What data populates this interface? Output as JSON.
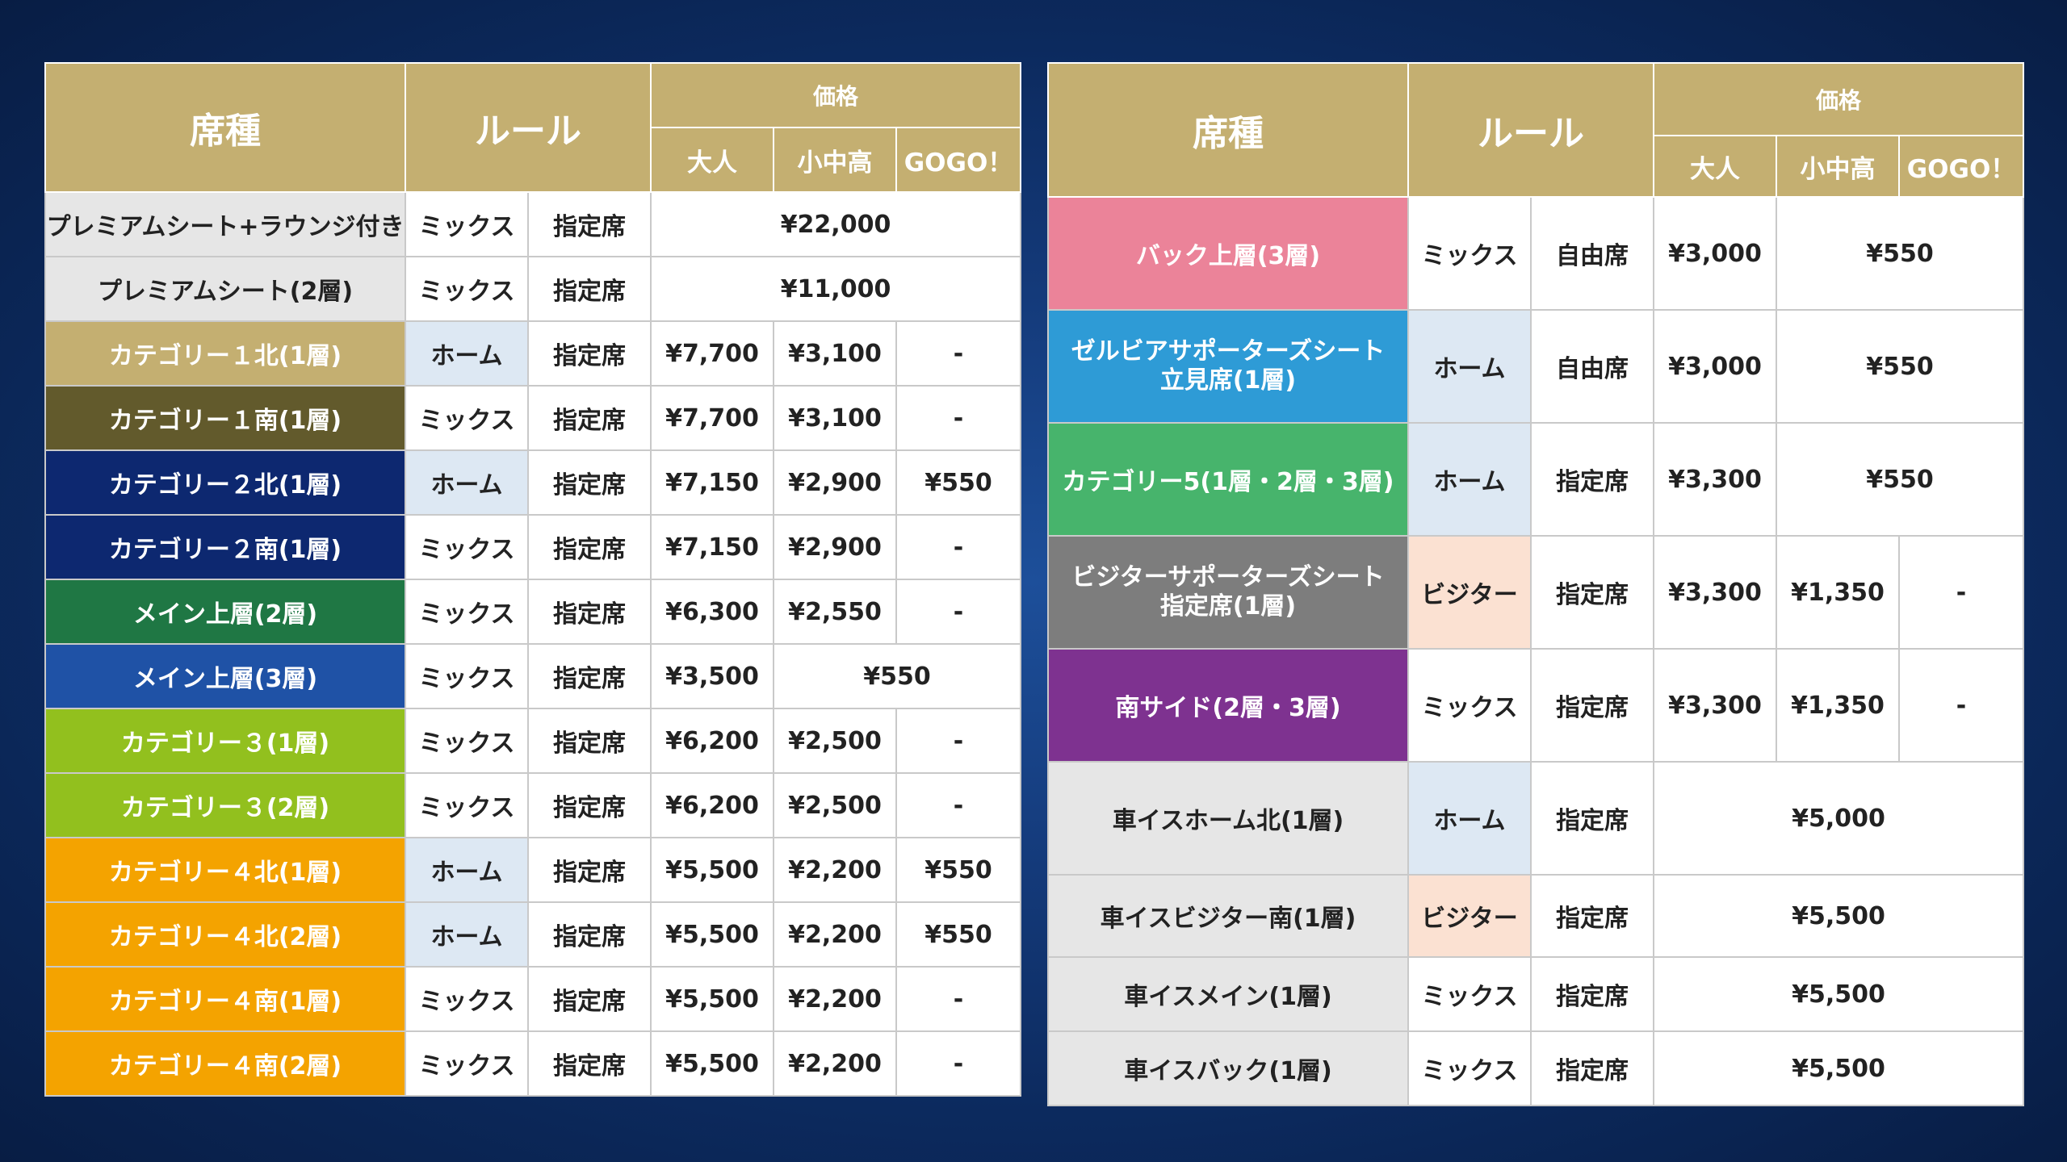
{
  "header": {
    "seat_type": "席種",
    "rule": "ルール",
    "price": "価格",
    "adult": "大人",
    "child": "小中高",
    "gogo": "GOGO！"
  },
  "colors": {
    "header_gold": "#c4af71",
    "home_bg": "#dde8f3",
    "visitor_bg": "#fbe1d2"
  },
  "left_table": [
    {
      "seat": "プレミアムシート+ラウンジ付き",
      "bg": "#e6e6e6",
      "fg": "#222222",
      "rule": "ミックス",
      "rule_type": "mix",
      "seating": "指定席",
      "prices": [
        "¥22,000"
      ],
      "spans": [
        3
      ]
    },
    {
      "seat": "プレミアムシート(2層)",
      "bg": "#e6e6e6",
      "fg": "#222222",
      "rule": "ミックス",
      "rule_type": "mix",
      "seating": "指定席",
      "prices": [
        "¥11,000"
      ],
      "spans": [
        3
      ]
    },
    {
      "seat": "カテゴリー１北(1層)",
      "bg": "#c4af71",
      "fg": "#ffffff",
      "rule": "ホーム",
      "rule_type": "home",
      "seating": "指定席",
      "prices": [
        "¥7,700",
        "¥3,100",
        "-"
      ],
      "spans": [
        1,
        1,
        1
      ]
    },
    {
      "seat": "カテゴリー１南(1層)",
      "bg": "#625a2c",
      "fg": "#ffffff",
      "rule": "ミックス",
      "rule_type": "mix",
      "seating": "指定席",
      "prices": [
        "¥7,700",
        "¥3,100",
        "-"
      ],
      "spans": [
        1,
        1,
        1
      ]
    },
    {
      "seat": "カテゴリー２北(1層)",
      "bg": "#0d2870",
      "fg": "#ffffff",
      "rule": "ホーム",
      "rule_type": "home",
      "seating": "指定席",
      "prices": [
        "¥7,150",
        "¥2,900",
        "¥550"
      ],
      "spans": [
        1,
        1,
        1
      ]
    },
    {
      "seat": "カテゴリー２南(1層)",
      "bg": "#0d2870",
      "fg": "#ffffff",
      "rule": "ミックス",
      "rule_type": "mix",
      "seating": "指定席",
      "prices": [
        "¥7,150",
        "¥2,900",
        "-"
      ],
      "spans": [
        1,
        1,
        1
      ]
    },
    {
      "seat": "メイン上層(2層)",
      "bg": "#1f7744",
      "fg": "#ffffff",
      "rule": "ミックス",
      "rule_type": "mix",
      "seating": "指定席",
      "prices": [
        "¥6,300",
        "¥2,550",
        "-"
      ],
      "spans": [
        1,
        1,
        1
      ]
    },
    {
      "seat": "メイン上層(3層)",
      "bg": "#1f52a6",
      "fg": "#ffffff",
      "rule": "ミックス",
      "rule_type": "mix",
      "seating": "指定席",
      "prices": [
        "¥3,500",
        "¥550"
      ],
      "spans": [
        1,
        2
      ]
    },
    {
      "seat": "カテゴリー３(1層)",
      "bg": "#92c01e",
      "fg": "#ffffff",
      "rule": "ミックス",
      "rule_type": "mix",
      "seating": "指定席",
      "prices": [
        "¥6,200",
        "¥2,500",
        "-"
      ],
      "spans": [
        1,
        1,
        1
      ]
    },
    {
      "seat": "カテゴリー３(2層)",
      "bg": "#92c01e",
      "fg": "#ffffff",
      "rule": "ミックス",
      "rule_type": "mix",
      "seating": "指定席",
      "prices": [
        "¥6,200",
        "¥2,500",
        "-"
      ],
      "spans": [
        1,
        1,
        1
      ]
    },
    {
      "seat": "カテゴリー４北(1層)",
      "bg": "#f4a300",
      "fg": "#ffffff",
      "rule": "ホーム",
      "rule_type": "home",
      "seating": "指定席",
      "prices": [
        "¥5,500",
        "¥2,200",
        "¥550"
      ],
      "spans": [
        1,
        1,
        1
      ]
    },
    {
      "seat": "カテゴリー４北(2層)",
      "bg": "#f4a300",
      "fg": "#ffffff",
      "rule": "ホーム",
      "rule_type": "home",
      "seating": "指定席",
      "prices": [
        "¥5,500",
        "¥2,200",
        "¥550"
      ],
      "spans": [
        1,
        1,
        1
      ]
    },
    {
      "seat": "カテゴリー４南(1層)",
      "bg": "#f4a300",
      "fg": "#ffffff",
      "rule": "ミックス",
      "rule_type": "mix",
      "seating": "指定席",
      "prices": [
        "¥5,500",
        "¥2,200",
        "-"
      ],
      "spans": [
        1,
        1,
        1
      ]
    },
    {
      "seat": "カテゴリー４南(2層)",
      "bg": "#f4a300",
      "fg": "#ffffff",
      "rule": "ミックス",
      "rule_type": "mix",
      "seating": "指定席",
      "prices": [
        "¥5,500",
        "¥2,200",
        "-"
      ],
      "spans": [
        1,
        1,
        1
      ]
    }
  ],
  "right_table": [
    {
      "seat": "バック上層(3層)",
      "bg": "#eb8399",
      "fg": "#ffffff",
      "rule": "ミックス",
      "rule_type": "mix",
      "seating": "自由席",
      "prices": [
        "¥3,000",
        "¥550"
      ],
      "spans": [
        1,
        2
      ]
    },
    {
      "seat": "ゼルビアサポーターズシート\n立見席(1層)",
      "bg": "#2e9bd6",
      "fg": "#ffffff",
      "rule": "ホーム",
      "rule_type": "home",
      "seating": "自由席",
      "prices": [
        "¥3,000",
        "¥550"
      ],
      "spans": [
        1,
        2
      ]
    },
    {
      "seat": "カテゴリー5(1層・2層・3層)",
      "bg": "#47b46c",
      "fg": "#ffffff",
      "rule": "ホーム",
      "rule_type": "home",
      "seating": "指定席",
      "prices": [
        "¥3,300",
        "¥550"
      ],
      "spans": [
        1,
        2
      ]
    },
    {
      "seat": "ビジターサポーターズシート\n指定席(1層)",
      "bg": "#7d7d7d",
      "fg": "#ffffff",
      "rule": "ビジター",
      "rule_type": "visitor",
      "seating": "指定席",
      "prices": [
        "¥3,300",
        "¥1,350",
        "-"
      ],
      "spans": [
        1,
        1,
        1
      ]
    },
    {
      "seat": "南サイド(2層・3層)",
      "bg": "#7e3290",
      "fg": "#ffffff",
      "rule": "ミックス",
      "rule_type": "mix",
      "seating": "指定席",
      "prices": [
        "¥3,300",
        "¥1,350",
        "-"
      ],
      "spans": [
        1,
        1,
        1
      ]
    },
    {
      "seat": "車イスホーム北(1層)",
      "bg": "#e6e6e6",
      "fg": "#222222",
      "rule": "ホーム",
      "rule_type": "home",
      "seating": "指定席",
      "prices": [
        "¥5,000"
      ],
      "spans": [
        3
      ]
    },
    {
      "seat": "車イスビジター南(1層)",
      "bg": "#e6e6e6",
      "fg": "#222222",
      "rule": "ビジター",
      "rule_type": "visitor",
      "seating": "指定席",
      "prices": [
        "¥5,500"
      ],
      "spans": [
        3
      ]
    },
    {
      "seat": "車イスメイン(1層)",
      "bg": "#e6e6e6",
      "fg": "#222222",
      "rule": "ミックス",
      "rule_type": "mix",
      "seating": "指定席",
      "prices": [
        "¥5,500"
      ],
      "spans": [
        3
      ]
    },
    {
      "seat": "車イスバック(1層)",
      "bg": "#e6e6e6",
      "fg": "#222222",
      "rule": "ミックス",
      "rule_type": "mix",
      "seating": "指定席",
      "prices": [
        "¥5,500"
      ],
      "spans": [
        3
      ]
    }
  ]
}
